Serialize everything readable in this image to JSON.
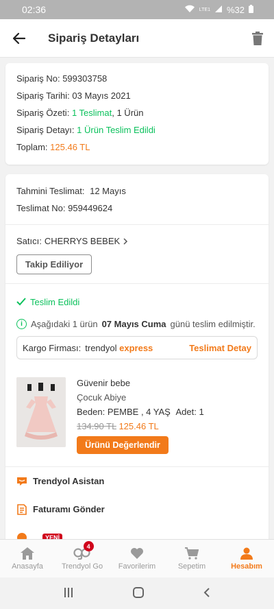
{
  "status_bar": {
    "time": "02:36",
    "network": "LTE1",
    "battery": "%32"
  },
  "header": {
    "title": "Sipariş Detayları"
  },
  "order_summary": {
    "order_no_label": "Sipariş No:",
    "order_no": "599303758",
    "order_date_label": "Sipariş Tarihi:",
    "order_date": "03 Mayıs 2021",
    "summary_label": "Sipariş Özeti:",
    "summary_delivery": "1 Teslimat",
    "summary_items": ", 1 Ürün",
    "detail_label": "Sipariş Detayı:",
    "detail_value": "1 Ürün Teslim Edildi",
    "total_label": "Toplam:",
    "total_value": "125.46 TL"
  },
  "delivery": {
    "estimated_label": "Tahmini Teslimat:",
    "estimated_value": "12 Mayıs",
    "delivery_no_label": "Teslimat No:",
    "delivery_no": "959449624",
    "seller_label": "Satıcı:",
    "seller_name": "CHERRYS BEBEK",
    "follow_button": "Takip Ediliyor",
    "status": "Teslim Edildi",
    "info_prefix": "Aşağıdaki 1 ürün",
    "info_date": "07 Mayıs Cuma",
    "info_suffix": "günü teslim edilmiştir.",
    "cargo_label": "Kargo Firması:",
    "cargo_brand": "trendyol",
    "cargo_brand_express": "express",
    "cargo_detail_link": "Teslimat Detay"
  },
  "product": {
    "brand": "Güvenir bebe",
    "name": "Çocuk Abiye",
    "variant_label": "Beden:",
    "variant_value": "PEMBE , 4 YAŞ",
    "qty_label": "Adet:",
    "qty_value": "1",
    "old_price": "134.90 TL",
    "price": "125.46 TL",
    "rate_button": "Ürünü Değerlendir"
  },
  "menu": {
    "items": [
      {
        "label": "Trendyol Asistan",
        "icon": "chat-icon"
      },
      {
        "label": "Faturamı Gönder",
        "icon": "invoice-icon"
      },
      {
        "label": "",
        "badge": "YENİ",
        "icon": "orange-circle-icon"
      }
    ]
  },
  "bottom_nav": {
    "items": [
      {
        "label": "Anasayfa",
        "icon": "home-icon"
      },
      {
        "label": "Trendyol Go",
        "icon": "go-icon",
        "badge": "4"
      },
      {
        "label": "Favorilerim",
        "icon": "heart-icon"
      },
      {
        "label": "Sepetim",
        "icon": "cart-icon"
      },
      {
        "label": "Hesabım",
        "icon": "person-icon",
        "active": true
      }
    ]
  },
  "colors": {
    "accent": "#f27a1a",
    "success": "#0bc15c",
    "badge": "#d0021b"
  }
}
